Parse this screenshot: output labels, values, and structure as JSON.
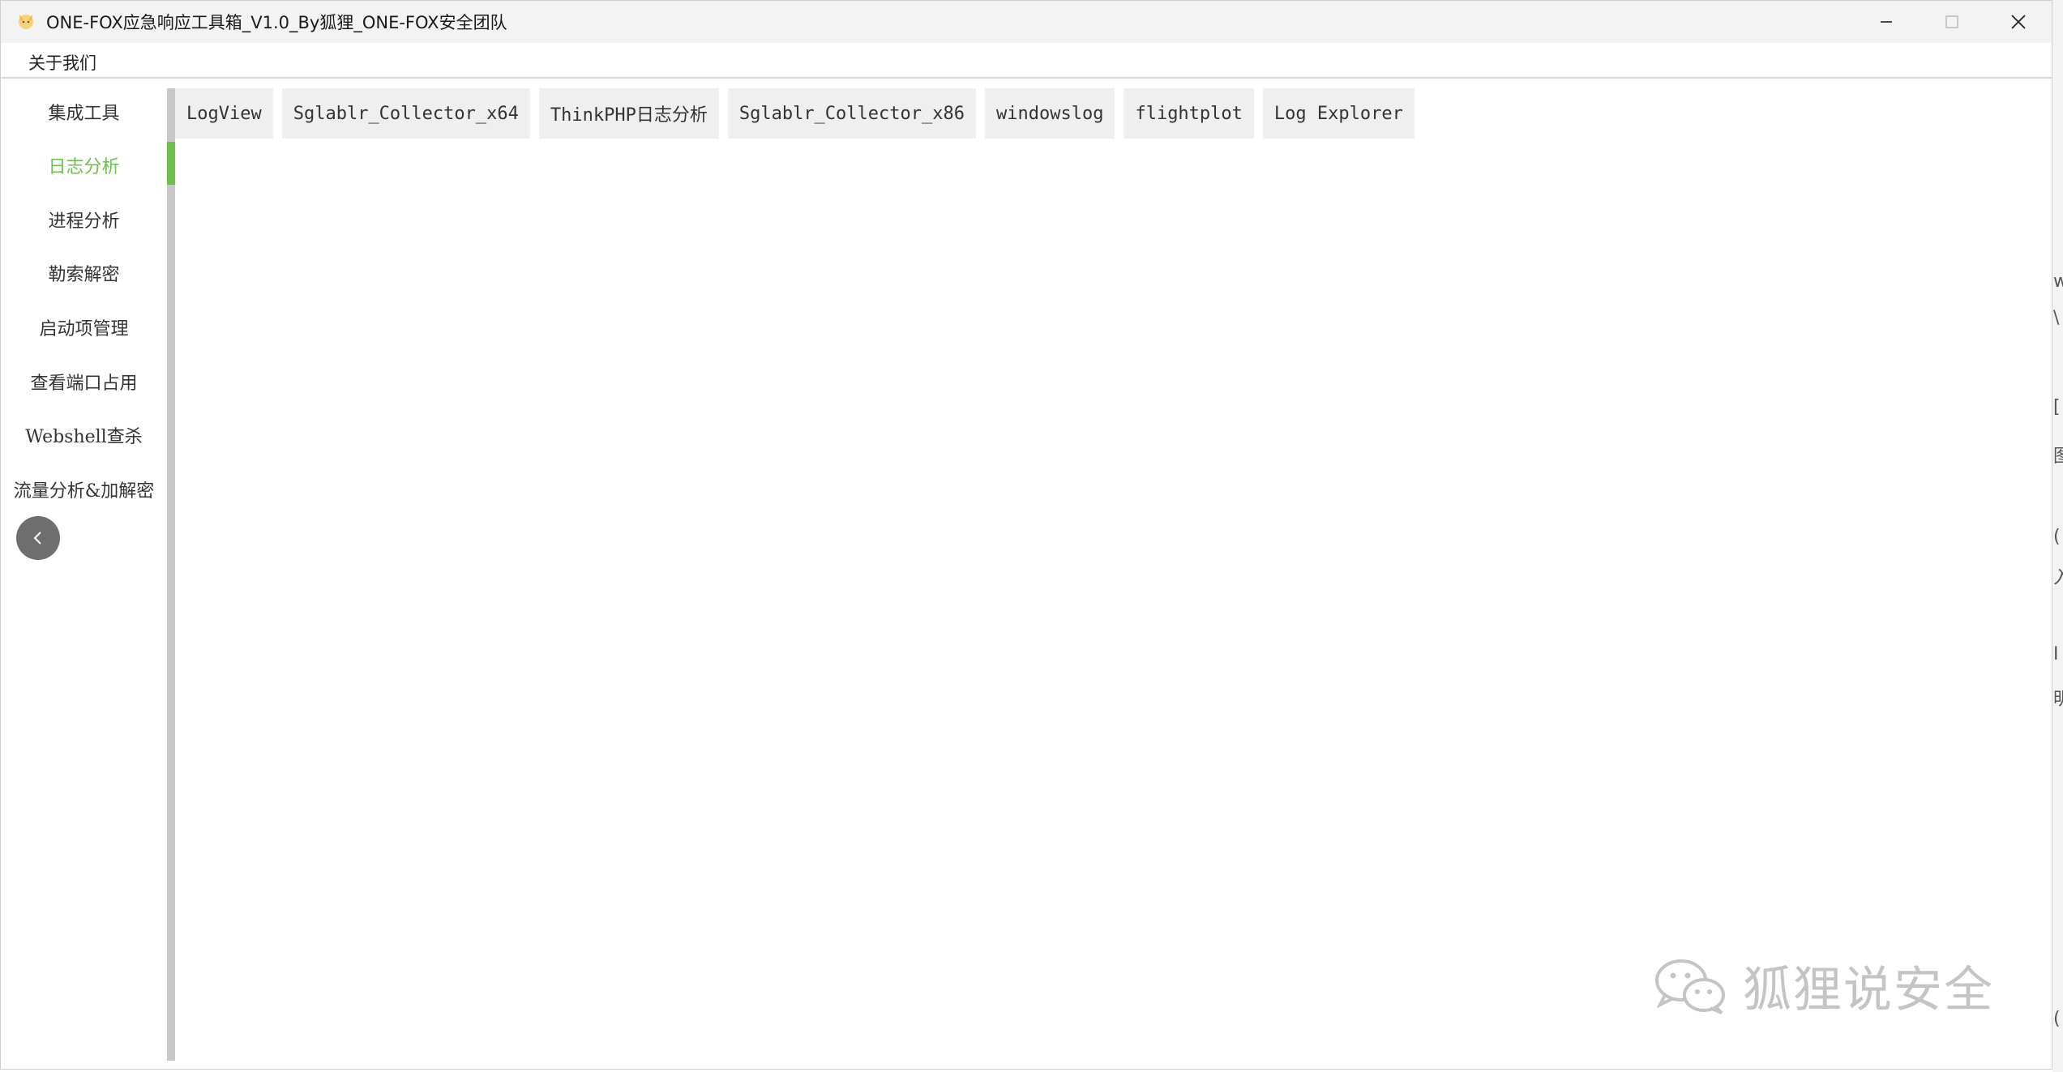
{
  "window": {
    "title": "ONE-FOX应急响应工具箱_V1.0_By狐狸_ONE-FOX安全团队"
  },
  "menu": {
    "about": "关于我们"
  },
  "sidebar": {
    "items": [
      {
        "label": "集成工具",
        "active": false
      },
      {
        "label": "日志分析",
        "active": true
      },
      {
        "label": "进程分析",
        "active": false
      },
      {
        "label": "勒索解密",
        "active": false
      },
      {
        "label": "启动项管理",
        "active": false
      },
      {
        "label": "查看端口占用",
        "active": false
      },
      {
        "label": "Webshell查杀",
        "active": false
      },
      {
        "label": "流量分析&加解密",
        "active": false
      }
    ],
    "collapse_icon": "chevron-left-icon"
  },
  "tabs": [
    {
      "label": "LogView"
    },
    {
      "label": "Sglablr_Collector_x64"
    },
    {
      "label": "ThinkPHP日志分析"
    },
    {
      "label": "Sglablr_Collector_x86"
    },
    {
      "label": "windowslog"
    },
    {
      "label": "flightplot"
    },
    {
      "label": "Log Explorer"
    }
  ],
  "watermark": {
    "text": "狐狸说安全",
    "icon": "wechat-icon"
  },
  "colors": {
    "accent": "#6cc24a",
    "tab_bg": "#efefef",
    "track": "#c8c8c8",
    "titlebar_bg": "#f3f3f3"
  }
}
